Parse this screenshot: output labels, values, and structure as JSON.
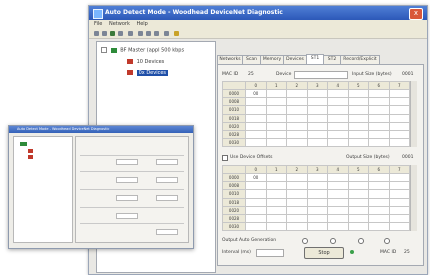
{
  "main_window": {
    "title": "Auto Detect Mode - Woodhead DeviceNet Diagnostic",
    "menu": [
      "File",
      "Network",
      "Help"
    ],
    "close_label": "x"
  },
  "tree": {
    "root_label": "BF Master (appl 500 kbps",
    "child1_label": "10 Devices",
    "child2_label": "0x Devices"
  },
  "tabs": [
    "Networks",
    "Scan",
    "Memory",
    "Devices",
    "ST1",
    "ST2",
    "Record/Explicit"
  ],
  "upper": {
    "macid_label": "MAC ID",
    "macid_value": "25",
    "device_label": "Device",
    "input_size_label": "Input Size (bytes)",
    "input_size_value": "0001",
    "col_headers": [
      "0",
      "1",
      "2",
      "3",
      "4",
      "5",
      "6",
      "7"
    ],
    "rows": [
      "0000",
      "0008",
      "0010",
      "0018",
      "0020",
      "0028",
      "0030"
    ],
    "first_cell": "00"
  },
  "lower": {
    "use_device_offsets_label": "Use Device Offsets",
    "output_size_label": "Output Size (bytes)",
    "output_size_value": "0001",
    "col_headers": [
      "0",
      "1",
      "2",
      "3",
      "4",
      "5",
      "6",
      "7"
    ],
    "rows": [
      "0000",
      "0008",
      "0010",
      "0018",
      "0020",
      "0028",
      "0030"
    ],
    "first_cell": "00"
  },
  "footer": {
    "output_auto_gen_label": "Output Auto Generation",
    "interval_label": "Interval (ms)",
    "start_button": "Stop",
    "macid_label": "MAC ID",
    "macid_value": "25"
  },
  "small_window": {
    "title": "Auto Detect Mode - Woodhead DeviceNet Diagnostic"
  }
}
